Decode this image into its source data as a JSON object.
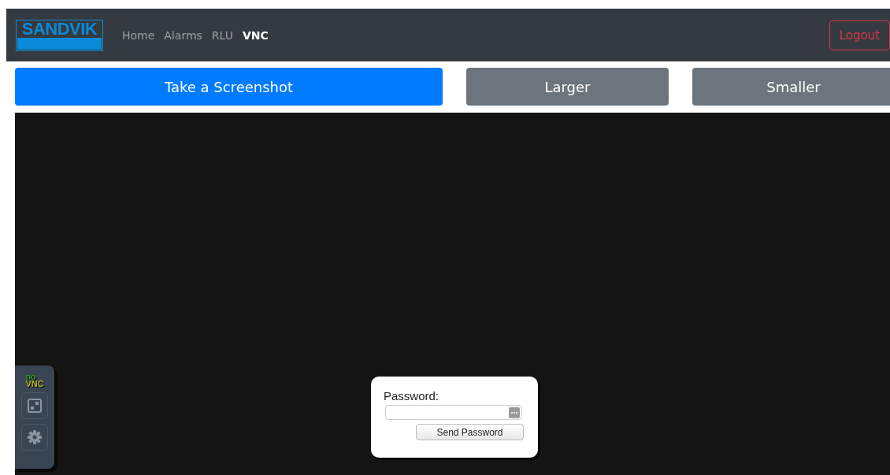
{
  "navbar": {
    "brand": "SANDVIK",
    "links": [
      {
        "label": "Home",
        "selected": false
      },
      {
        "label": "Alarms",
        "selected": false
      },
      {
        "label": "RLU",
        "selected": false
      },
      {
        "label": "VNC",
        "selected": true
      }
    ],
    "logout": "Logout"
  },
  "actions": [
    {
      "label": "Take a Screenshot",
      "kind": "primary"
    },
    {
      "label": "Larger",
      "kind": "secondary"
    },
    {
      "label": "Smaller",
      "kind": "secondary"
    }
  ],
  "vnc": {
    "logo": [
      "no",
      "VNC"
    ],
    "password_dialog": {
      "label": "Password:",
      "button": "Send Password"
    }
  }
}
